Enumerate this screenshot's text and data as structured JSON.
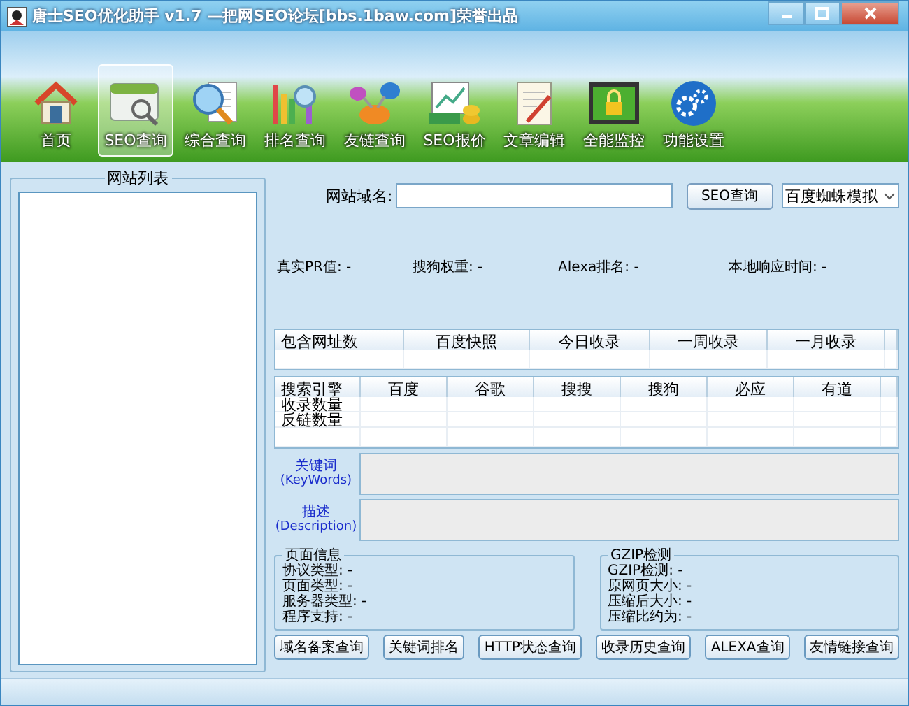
{
  "window": {
    "title": "唐士SEO优化助手 v1.7 —把网SEO论坛[bbs.1baw.com]荣誉出品"
  },
  "toolbar": [
    {
      "label": "首页",
      "kind": "home",
      "selected": false
    },
    {
      "label": "SEO查询",
      "kind": "seo",
      "selected": true
    },
    {
      "label": "综合查询",
      "kind": "search",
      "selected": false
    },
    {
      "label": "排名查询",
      "kind": "ranking",
      "selected": false
    },
    {
      "label": "友链查询",
      "kind": "links",
      "selected": false
    },
    {
      "label": "SEO报价",
      "kind": "price",
      "selected": false
    },
    {
      "label": "文章编辑",
      "kind": "edit",
      "selected": false
    },
    {
      "label": "全能监控",
      "kind": "monitor",
      "selected": false
    },
    {
      "label": "功能设置",
      "kind": "settings",
      "selected": false
    }
  ],
  "site_list": {
    "title": "网站列表"
  },
  "domain_field": {
    "label": "网站域名:"
  },
  "query_button": "SEO查询",
  "engine_select": {
    "value": "百度蜘蛛模拟"
  },
  "stats": [
    {
      "label": "真实PR值:",
      "value": "-"
    },
    {
      "label": "搜狗权重:",
      "value": "-"
    },
    {
      "label": "Alexa排名:",
      "value": "-"
    },
    {
      "label": "本地响应时间:",
      "value": "-"
    }
  ],
  "index_table": {
    "columns": [
      "包含网址数",
      "百度快照",
      "今日收录",
      "一周收录",
      "一月收录"
    ]
  },
  "engine_table": {
    "columns": [
      "搜索引擎",
      "百度",
      "谷歌",
      "搜搜",
      "搜狗",
      "必应",
      "有道"
    ],
    "rows": [
      "收录数量",
      "反链数量"
    ]
  },
  "meta_fields": [
    {
      "label": "关键词",
      "sublabel": "(KeyWords)"
    },
    {
      "label": "描述",
      "sublabel": "(Description)"
    }
  ],
  "page_info": {
    "title": "页面信息",
    "lines": [
      "协议类型: -",
      "页面类型: -",
      "服务器类型: -",
      "程序支持: -"
    ]
  },
  "gzip": {
    "title": "GZIP检测",
    "lines": [
      "GZIP检测: -",
      "原网页大小: -",
      "压缩后大小: -",
      "压缩比约为: -"
    ]
  },
  "buttons": [
    "域名备案查询",
    "关键词排名",
    "HTTP状态查询",
    "收录历史查询",
    "ALEXA查询",
    "友情链接查询"
  ]
}
